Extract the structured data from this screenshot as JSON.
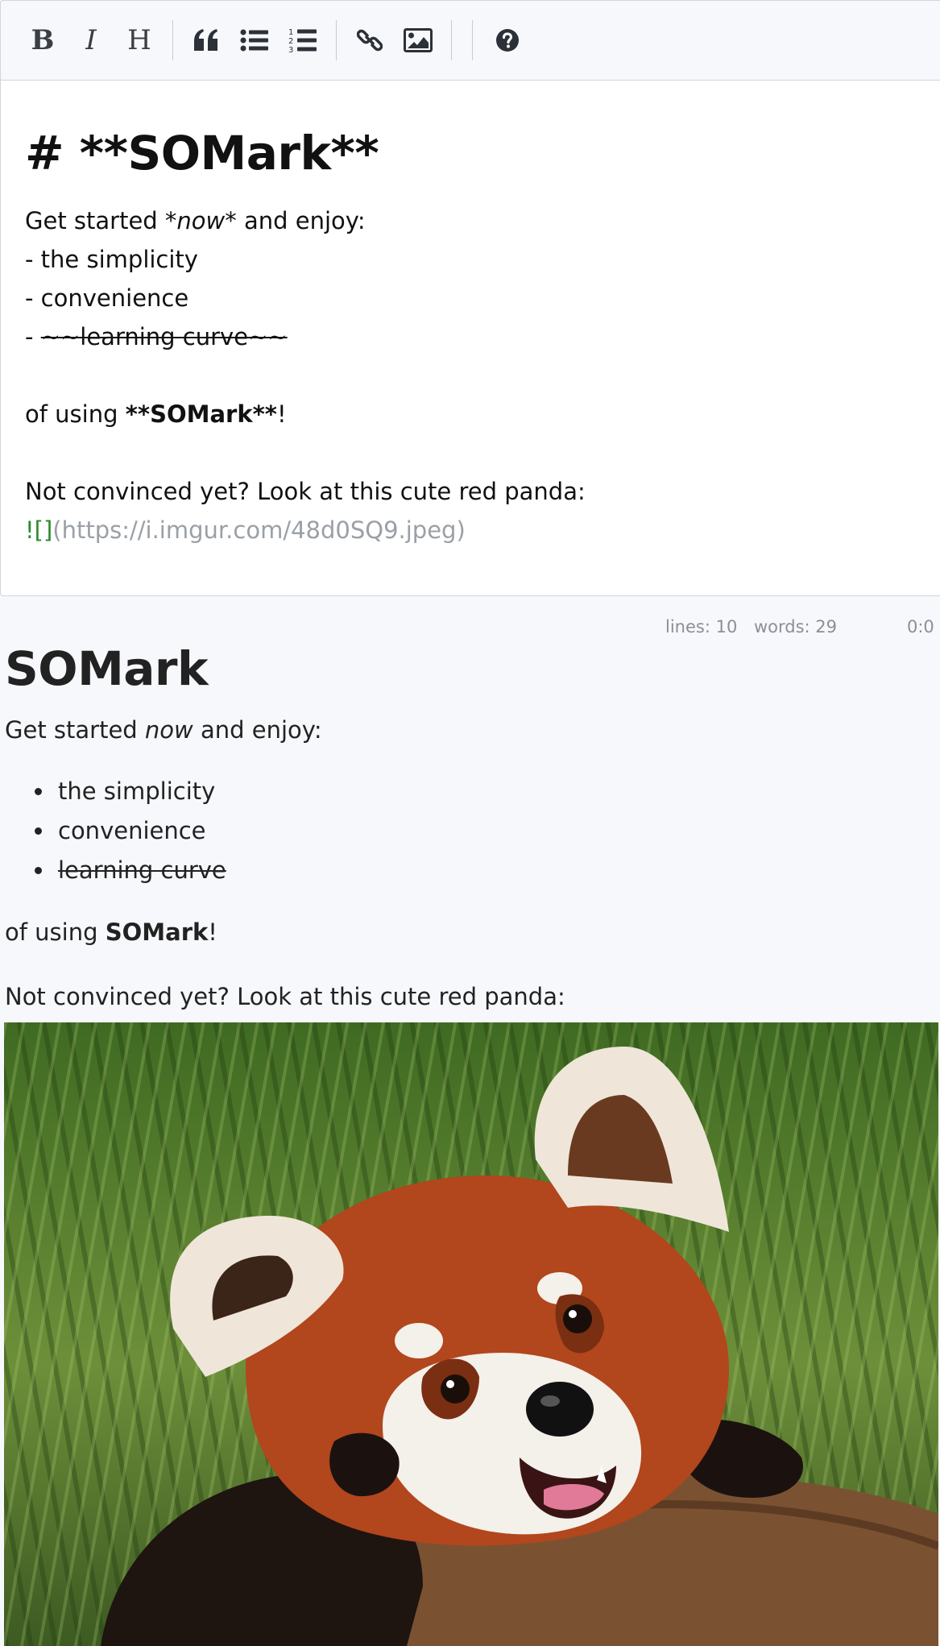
{
  "toolbar": {
    "bold": "B",
    "italic": "I",
    "heading": "H"
  },
  "editor": {
    "heading": "# **SOMark**",
    "line1_pre": "Get started ",
    "line1_em": "*now*",
    "line1_post": " and enjoy:",
    "item1": "- the simplicity",
    "item2": "- convenience",
    "item3_dash": "- ",
    "item3_strike": "~~learning curve~~",
    "using_pre": "of using ",
    "using_bold": "**SOMark**",
    "using_post": "!",
    "panda_line": "Not convinced yet? Look at this cute red panda:",
    "img_bang": "![]",
    "img_url": "(https://i.imgur.com/48d0SQ9.jpeg)"
  },
  "status": {
    "lines": "lines: 10",
    "words": "words: 29",
    "cursor": "0:0"
  },
  "preview": {
    "title": "SOMark",
    "intro_pre": "Get started ",
    "intro_em": "now",
    "intro_post": " and enjoy:",
    "items": [
      "the simplicity",
      "convenience",
      "learning curve"
    ],
    "using_pre": "of using ",
    "using_bold": "SOMark",
    "using_post": "!",
    "panda_line": "Not convinced yet? Look at this cute red panda:"
  },
  "icons": [
    "quote-icon",
    "bullet-list-icon",
    "numbered-list-icon",
    "link-icon",
    "image-icon",
    "help-icon"
  ]
}
